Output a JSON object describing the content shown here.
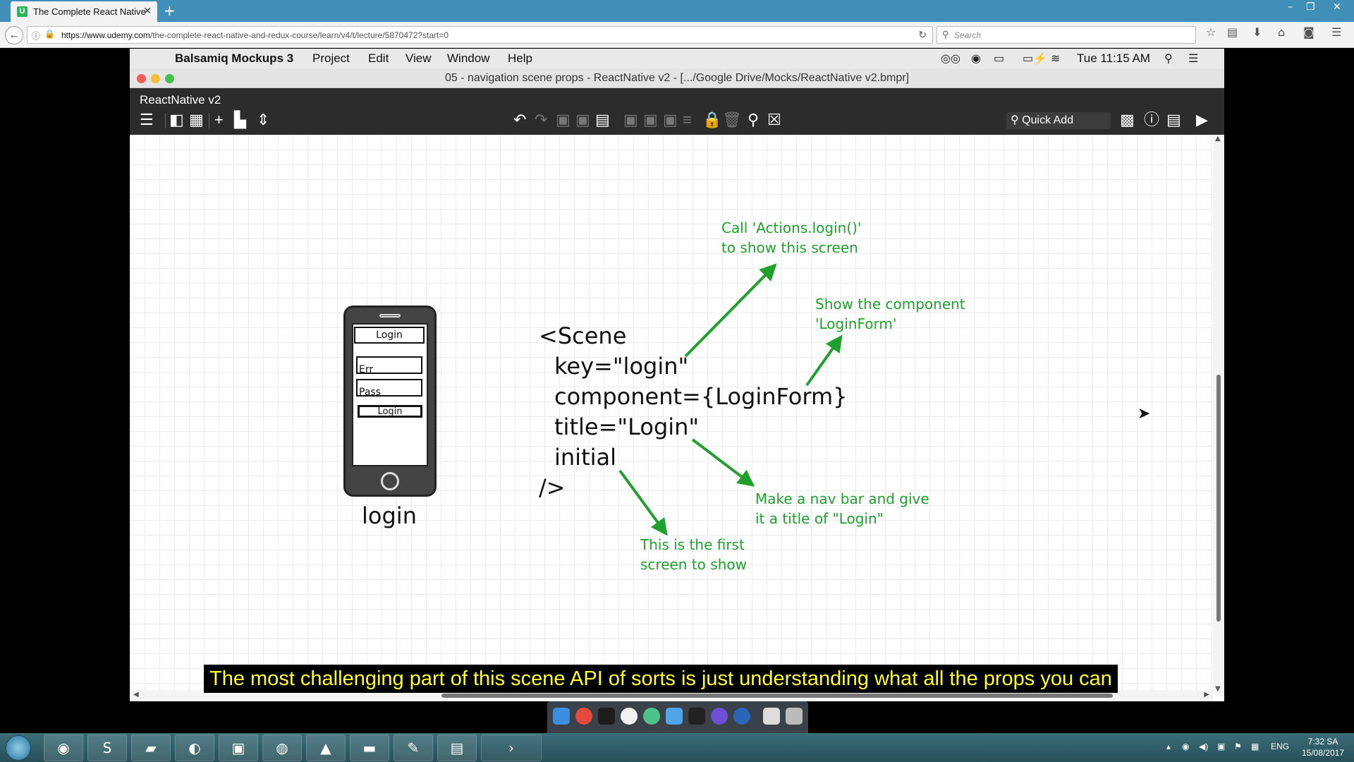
{
  "browser": {
    "tab_title": "The Complete React Native",
    "tab_favicon": "U",
    "url_domain": "https://www.udemy.com",
    "url_path": "/the-complete-react-native-and-redux-course/learn/v4/t/lecture/5870472?start=0",
    "search_placeholder": "Search"
  },
  "mac": {
    "menubar": {
      "app": "Balsamiq Mockups 3",
      "items": [
        "Project",
        "Edit",
        "View",
        "Window",
        "Help"
      ],
      "clock": "Tue 11:15 AM"
    },
    "window_title": "05 - navigation scene props - ReactNative v2 - [.../Google Drive/Mocks/ReactNative v2.bmpr]",
    "project_name": "ReactNative v2",
    "quick_add": "Quick Add"
  },
  "mockup": {
    "phone": {
      "header": "Login",
      "field1": "Err",
      "field2": "Pass",
      "button": "Login",
      "caption": "login"
    },
    "code_lines": [
      "<Scene",
      "key=\"login\"",
      "component={LoginForm}",
      "title=\"Login\"",
      "initial",
      "/>"
    ],
    "notes": {
      "actions_line1": "Call 'Actions.login()'",
      "actions_line2": "to show this screen",
      "component_line1": "Show the component",
      "component_line2": "'LoginForm'",
      "title_line1": "Make a nav bar and give",
      "title_line2": "it a title of \"Login\"",
      "initial_line1": "This is the first",
      "initial_line2": "screen to show"
    },
    "arrow_color": "#1fa12e"
  },
  "subtitle": "The most challenging part of this scene API of sorts is just understanding what all the props you can",
  "taskbar": {
    "lang": "ENG",
    "time": "7:32 SA",
    "date": "15/08/2017"
  }
}
